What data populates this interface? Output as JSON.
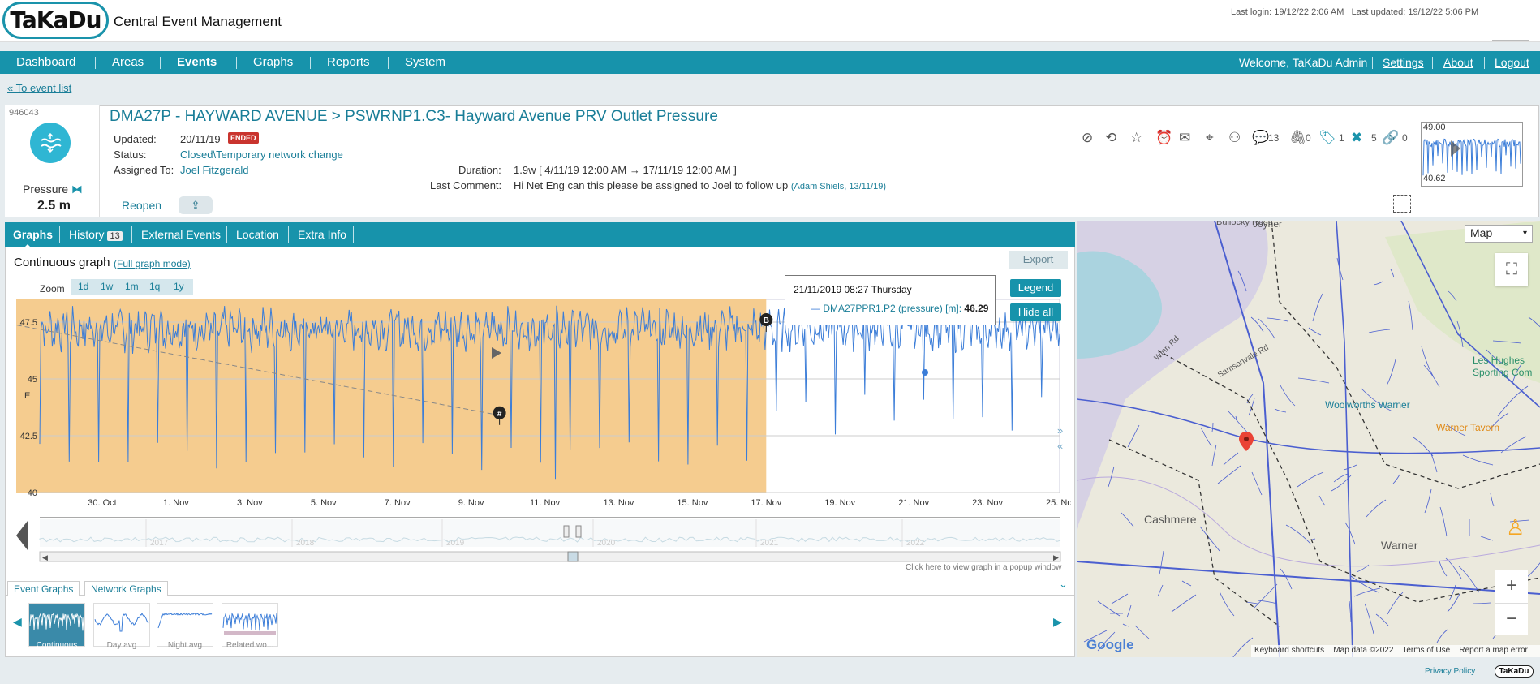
{
  "header": {
    "logo_text": "TaKaDu",
    "app_title": "Central Event Management",
    "last_login": "Last login: 19/12/22 2:06 AM",
    "last_updated": "Last updated: 19/12/22 5:06 PM"
  },
  "nav": {
    "items": [
      "Dashboard",
      "Areas",
      "Events",
      "Graphs",
      "Reports",
      "System"
    ],
    "active": "Events",
    "welcome": "Welcome, TaKaDu Admin",
    "links": [
      "Settings",
      "About",
      "Logout"
    ]
  },
  "back_link": "« To event list",
  "event": {
    "id": "946043",
    "type_label": "Pressure",
    "value": "2.5 m",
    "title": "DMA27P - HAYWARD AVENUE > PSWRNP1.C3- Hayward Avenue PRV Outlet Pressure",
    "updated_label": "Updated:",
    "updated": "20/11/19",
    "ended_badge": "ENDED",
    "status_label": "Status:",
    "status": "Closed\\Temporary network change",
    "assigned_label": "Assigned To:",
    "assigned": "Joel Fitzgerald",
    "duration_label": "Duration:",
    "duration": "1.9w [ 4/11/19 12:00 AM → 17/11/19 12:00 AM ]",
    "comment_label": "Last Comment:",
    "comment": "Hi Net Eng can this please be assigned to Joel to follow up",
    "comment_meta": "(Adam Shiels, 13/11/19)",
    "reopen": "Reopen"
  },
  "toolbar_counts": {
    "comments": "13",
    "attachments": "0",
    "tags": "1",
    "tools": "5",
    "links": "0"
  },
  "mini_chart": {
    "max": "49.00",
    "min": "40.62"
  },
  "tabs": [
    {
      "label": "Graphs"
    },
    {
      "label": "History",
      "badge": "13"
    },
    {
      "label": "External Events"
    },
    {
      "label": "Location"
    },
    {
      "label": "Extra Info"
    }
  ],
  "graph_panel": {
    "title": "Continuous graph",
    "full_mode": "(Full graph mode)",
    "export": "Export",
    "zoom_label": "Zoom",
    "zoom_options": [
      "1d",
      "1w",
      "1m",
      "1q",
      "1y"
    ],
    "legend_btn": "Legend",
    "hide_all_btn": "Hide all",
    "tooltip": {
      "date": "21/11/2019 08:27 Thursday",
      "series": "DMA27PPR1.P2 (pressure) [m]:",
      "value": "46.29"
    },
    "popup_hint": "Click here to view graph in a popup window",
    "bottom_tabs": [
      "Event Graphs",
      "Network Graphs"
    ],
    "thumbnails": [
      "Continuous",
      "Day avg",
      "Night avg",
      "Related wo..."
    ]
  },
  "chart_data": {
    "type": "line",
    "ylabel": "E",
    "ylim": [
      40,
      48.5
    ],
    "y_ticks": [
      "47.5",
      "45",
      "42.5",
      "40"
    ],
    "x_ticks": [
      "30. Oct",
      "1. Nov",
      "3. Nov",
      "5. Nov",
      "7. Nov",
      "9. Nov",
      "11. Nov",
      "13. Nov",
      "15. Nov",
      "17. Nov",
      "19. Nov",
      "21. Nov",
      "23. Nov",
      "25. Nov"
    ],
    "series": [
      {
        "name": "DMA27PPR1.P2 (pressure) [m]",
        "color": "#3b7dd8"
      }
    ],
    "event_band": {
      "start": "4. Nov",
      "end": "17. Nov",
      "color": "#f5cc8f"
    },
    "markers": [
      {
        "label": "A",
        "x": "4. Nov",
        "y": 47.5
      },
      {
        "label": "B",
        "x": "17. Nov",
        "y": 47.5
      },
      {
        "label": "#",
        "x": "10. Nov",
        "y": 43.4
      }
    ],
    "navigator_years": [
      "2017",
      "2018",
      "2019",
      "2020",
      "2021",
      "2022"
    ]
  },
  "map": {
    "type_select": "Map",
    "labels": [
      "Joyner",
      "Bullocky Rest",
      "Winn Rd",
      "Samsonvale Rd",
      "Woolworths Warner",
      "Warner Tavern",
      "Cashmere",
      "Warner",
      "Les Hughes Sporting Com"
    ],
    "footer": [
      "Keyboard shortcuts",
      "Map data ©2022",
      "Terms of Use",
      "Report a map error"
    ],
    "google": "Google"
  },
  "footer": {
    "privacy": "Privacy Policy",
    "logo": "TaKaDu"
  },
  "colors": {
    "brand": "#1793ab",
    "event_band": "#f5cc8f",
    "series": "#3b7dd8",
    "ended": "#c9342e"
  }
}
